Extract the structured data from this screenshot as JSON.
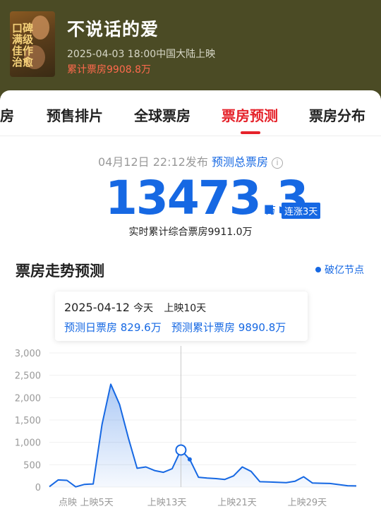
{
  "movie": {
    "title": "不说话的爱",
    "release": "2025-04-03 18:00中国大陆上映",
    "total_box": "累计票房9908.8万",
    "poster_text": "口碑满级 佳作治愈"
  },
  "tabs": [
    {
      "label": "票房"
    },
    {
      "label": "预售排片"
    },
    {
      "label": "全球票房"
    },
    {
      "label": "票房预测",
      "active": true
    },
    {
      "label": "票房分布"
    }
  ],
  "forecast": {
    "published": "04月12日 22:12发布",
    "label": "预测总票房",
    "value": "13473.3",
    "unit": "万",
    "badge": "连涨3天",
    "realtime": "实时累计综合票房9911.0万"
  },
  "trend": {
    "title": "票房走势预测",
    "legend": "破亿节点"
  },
  "tooltip": {
    "date": "2025-04-12",
    "today": "今天",
    "days": "上映10天",
    "daily": "预测日票房 829.6万",
    "cumulative": "预测累计票房 9890.8万"
  },
  "colors": {
    "accent": "#1668e3",
    "tab_active": "#e5222a",
    "header_bg": "#4b4b25"
  },
  "chart_data": {
    "type": "area",
    "ylim": [
      0,
      3000
    ],
    "y_ticks": [
      "3,000",
      "2,500",
      "2,000",
      "1,500",
      "1,000",
      "500",
      "0"
    ],
    "x_ticks": [
      "点映",
      "上映5天",
      "上映13天",
      "上映21天",
      "上映29天"
    ],
    "series": [
      {
        "values": [
          10,
          160,
          150,
          5,
          60,
          70,
          1400,
          2300,
          1850,
          1100,
          420,
          450,
          370,
          330,
          410,
          830,
          620,
          220,
          200,
          190,
          170,
          250,
          450,
          350,
          120,
          115,
          105,
          100,
          130,
          230,
          90,
          85,
          80,
          55,
          30,
          25
        ]
      }
    ],
    "highlight": {
      "label": "上映10天",
      "value": 829.6
    }
  }
}
